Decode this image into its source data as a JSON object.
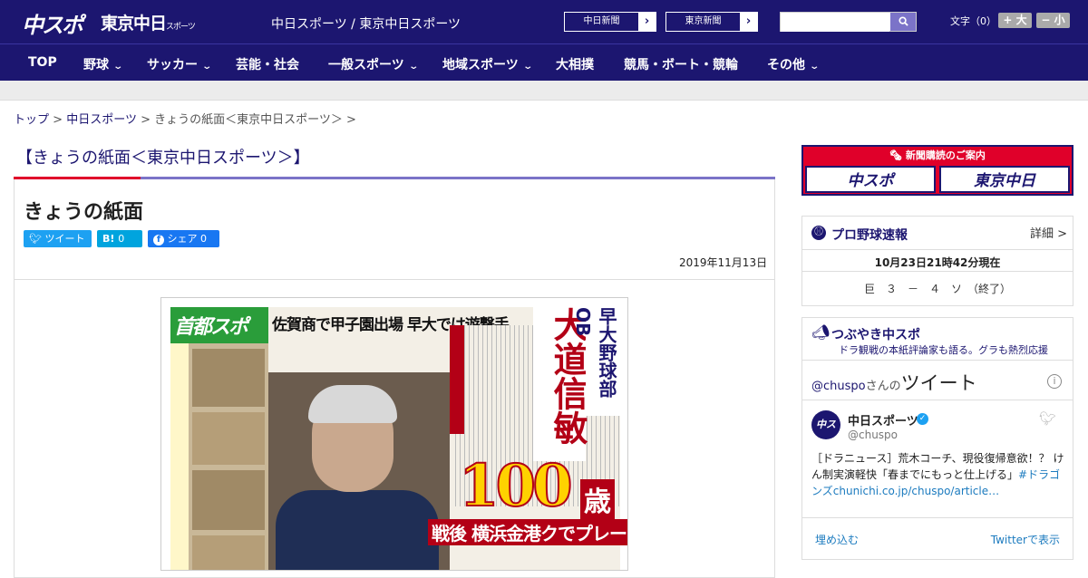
{
  "header": {
    "logo_chuspo": "中スポ",
    "logo_tokyo": "東京中日",
    "logo_tokyo_sub": "スポーツ",
    "site_name": "中日スポーツ / 東京中日スポーツ",
    "paper_links": [
      {
        "label": "中日新聞",
        "arrow": "›"
      },
      {
        "label": "東京新聞",
        "arrow": "›"
      }
    ],
    "search_placeholder": "",
    "search_icon": "search-icon",
    "font_size_label": "文字（0）",
    "font_larger": "+ 大",
    "font_smaller": "− 小"
  },
  "nav": [
    {
      "label": "TOP",
      "has_dropdown": false
    },
    {
      "label": "野球",
      "has_dropdown": true
    },
    {
      "label": "サッカー",
      "has_dropdown": true
    },
    {
      "label": "芸能・社会",
      "has_dropdown": false
    },
    {
      "label": "一般スポーツ",
      "has_dropdown": true
    },
    {
      "label": "地域スポーツ",
      "has_dropdown": true
    },
    {
      "label": "大相撲",
      "has_dropdown": false
    },
    {
      "label": "競馬・ボート・競輪",
      "has_dropdown": false
    },
    {
      "label": "その他",
      "has_dropdown": true
    }
  ],
  "breadcrumb": {
    "home": "トップ",
    "sep": ">",
    "section": "中日スポーツ",
    "current": "きょうの紙面＜東京中日スポーツ＞"
  },
  "page": {
    "section_title": "【きょうの紙面＜東京中日スポーツ＞】",
    "title": "きょうの紙面",
    "share": {
      "tweet": "ツイート",
      "hatena": "B!",
      "hatena_count": "0",
      "facebook": "シェア",
      "facebook_count": "0"
    },
    "date": "2019年11月13日"
  },
  "front_page": {
    "masthead": "首都スポ",
    "headline": "佐賀商で甲子園出場 早大では遊撃手",
    "big_vertical": "大道信敏",
    "ob_label": "早大野球部OB",
    "hundred": "100",
    "sai": "歳",
    "bottom_line": "戦後 横浜金港クでプレー"
  },
  "sidebar": {
    "subscription_header": "新聞購読のご案内",
    "subscription_buttons": [
      "中スポ",
      "東京中日"
    ],
    "baseball": {
      "title": "プロ野球速報",
      "detail": "詳細 >",
      "updated": "10月23日21時42分現在",
      "score_line": "巨　３　－　４　ソ　（終了）"
    },
    "twitter": {
      "title": "つぶやき中スポ",
      "subtitle": "ドラ観戦の本紙評論家も語る。グラも熱烈応援",
      "handle_prefix": "@chuspo",
      "handle_suffix": "さんの",
      "tweets_label": "ツイート",
      "author_name": "中日スポーツ",
      "author_handle": "@chuspo",
      "tweet_text": "［ドラニュース］荒木コーチ、現役復帰意欲！？ けん制実演軽快「春までにもっと仕上げる」",
      "tweet_link": "#ドラゴンズchunichi.co.jp/chuspo/article…",
      "embed": "埋め込む",
      "view_on_twitter": "Twitterで表示"
    }
  },
  "colors": {
    "navy": "#1c1670",
    "accent_purple": "#7b73c8",
    "red": "#e0002a",
    "twitter_blue": "#1da1f2",
    "facebook_blue": "#1877f2",
    "hatena_blue": "#00a4de"
  }
}
